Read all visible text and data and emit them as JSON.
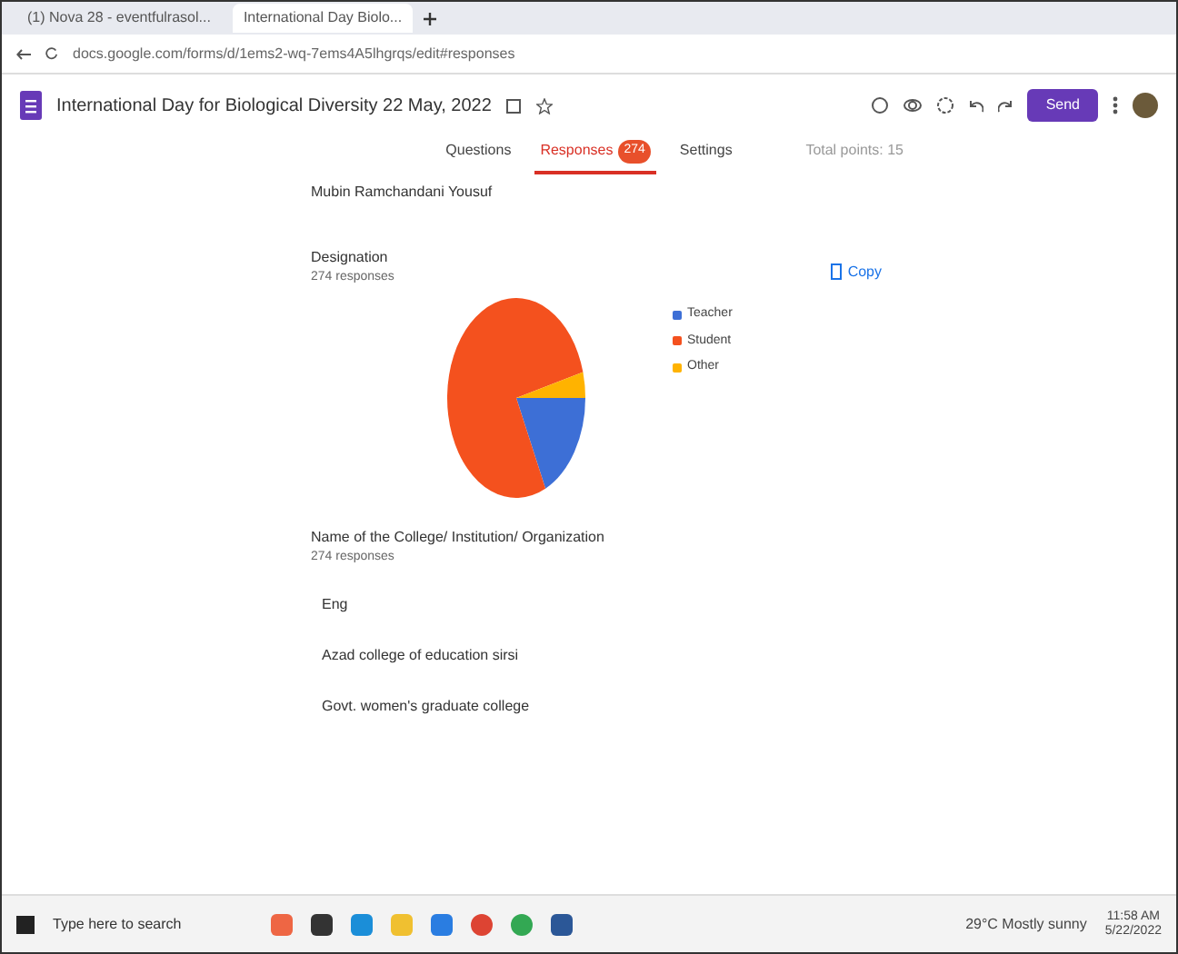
{
  "browser": {
    "tabs": [
      {
        "label": "(1) Nova 28 - eventfulrasol...",
        "selected": false
      },
      {
        "label": "International Day Biolo...",
        "selected": true
      }
    ],
    "url": "docs.google.com/forms/d/1ems2-wq-7ems4A5lhgrqs/edit#responses"
  },
  "form_header": {
    "title": "International Day for Biological Diversity 22 May, 2022",
    "send_button": "Send"
  },
  "form_tabs": [
    {
      "label": "Questions",
      "selected": false
    },
    {
      "label": "Responses",
      "selected": true,
      "badge": "274"
    },
    {
      "label": "Settings",
      "selected": false
    }
  ],
  "total_points": "Total points: 15",
  "previous_answer": "Mubin Ramchandani Yousuf",
  "questions": [
    {
      "kind": "pie",
      "title": "Designation",
      "count": "274 responses",
      "copy_label": "Copy",
      "legend": [
        {
          "label": "Teacher",
          "color": "#3d6fd6"
        },
        {
          "label": "Student",
          "color": "#f4511e"
        },
        {
          "label": "Other",
          "color": "#ffb300"
        }
      ]
    },
    {
      "kind": "list",
      "title": "Name of the College/ Institution/ Organization",
      "count": "274 responses",
      "answers": [
        "Eng",
        "Azad college of education sirsi",
        "Govt. women's graduate college"
      ]
    }
  ],
  "taskbar": {
    "search": "Type here to search",
    "weather": "29°C Mostly sunny",
    "time": "11:58 AM",
    "date": "5/22/2022"
  }
}
